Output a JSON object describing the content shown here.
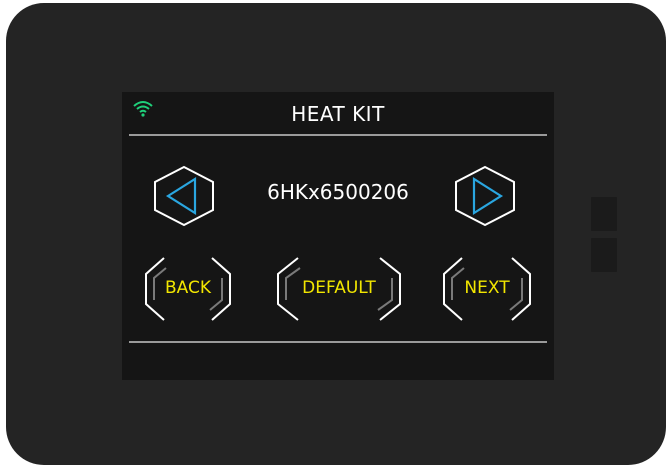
{
  "header": {
    "title": "HEAT KIT",
    "wifi_icon": "wifi-icon",
    "wifi_color": "#1fd07a"
  },
  "selector": {
    "value": "6HKx6500206",
    "prev_icon": "triangle-left-icon",
    "next_icon": "triangle-right-icon",
    "arrow_color": "#2aa6e0"
  },
  "buttons": {
    "back_label": "BACK",
    "default_label": "DEFAULT",
    "next_label": "NEXT",
    "label_color": "#f2e600"
  }
}
